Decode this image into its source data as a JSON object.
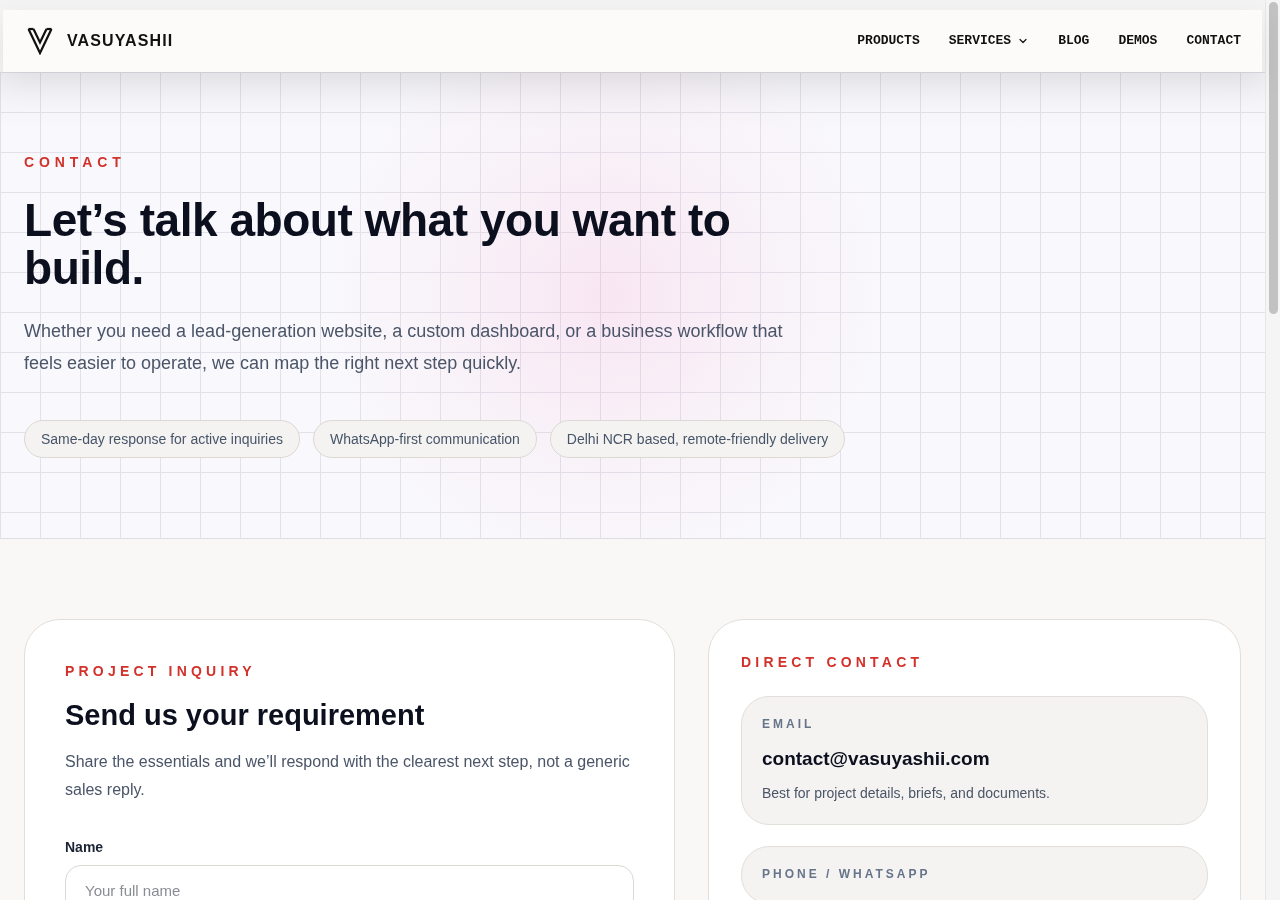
{
  "header": {
    "brand": "VASUYASHII",
    "nav": [
      {
        "label": "PRODUCTS",
        "dropdown": false
      },
      {
        "label": "SERVICES",
        "dropdown": true
      },
      {
        "label": "BLOG",
        "dropdown": false
      },
      {
        "label": "DEMOS",
        "dropdown": false
      },
      {
        "label": "CONTACT",
        "dropdown": false
      }
    ]
  },
  "hero": {
    "eyebrow": "CONTACT",
    "title": "Let’s talk about what you want to build.",
    "description": "Whether you need a lead-generation website, a custom dashboard, or a business workflow that feels easier to operate, we can map the right next step quickly.",
    "chips": [
      "Same-day response for active inquiries",
      "WhatsApp-first communication",
      "Delhi NCR based, remote-friendly delivery"
    ]
  },
  "inquiry_form": {
    "eyebrow": "PROJECT INQUIRY",
    "title": "Send us your requirement",
    "description": "Share the essentials and we’ll respond with the clearest next step, not a generic sales reply.",
    "fields": [
      {
        "label": "Name",
        "placeholder": "Your full name"
      }
    ]
  },
  "direct_contact": {
    "eyebrow": "DIRECT CONTACT",
    "methods": [
      {
        "label": "EMAIL",
        "value": "contact@vasuyashii.com",
        "note": "Best for project details, briefs, and documents."
      },
      {
        "label": "PHONE / WHATSAPP"
      }
    ]
  }
}
